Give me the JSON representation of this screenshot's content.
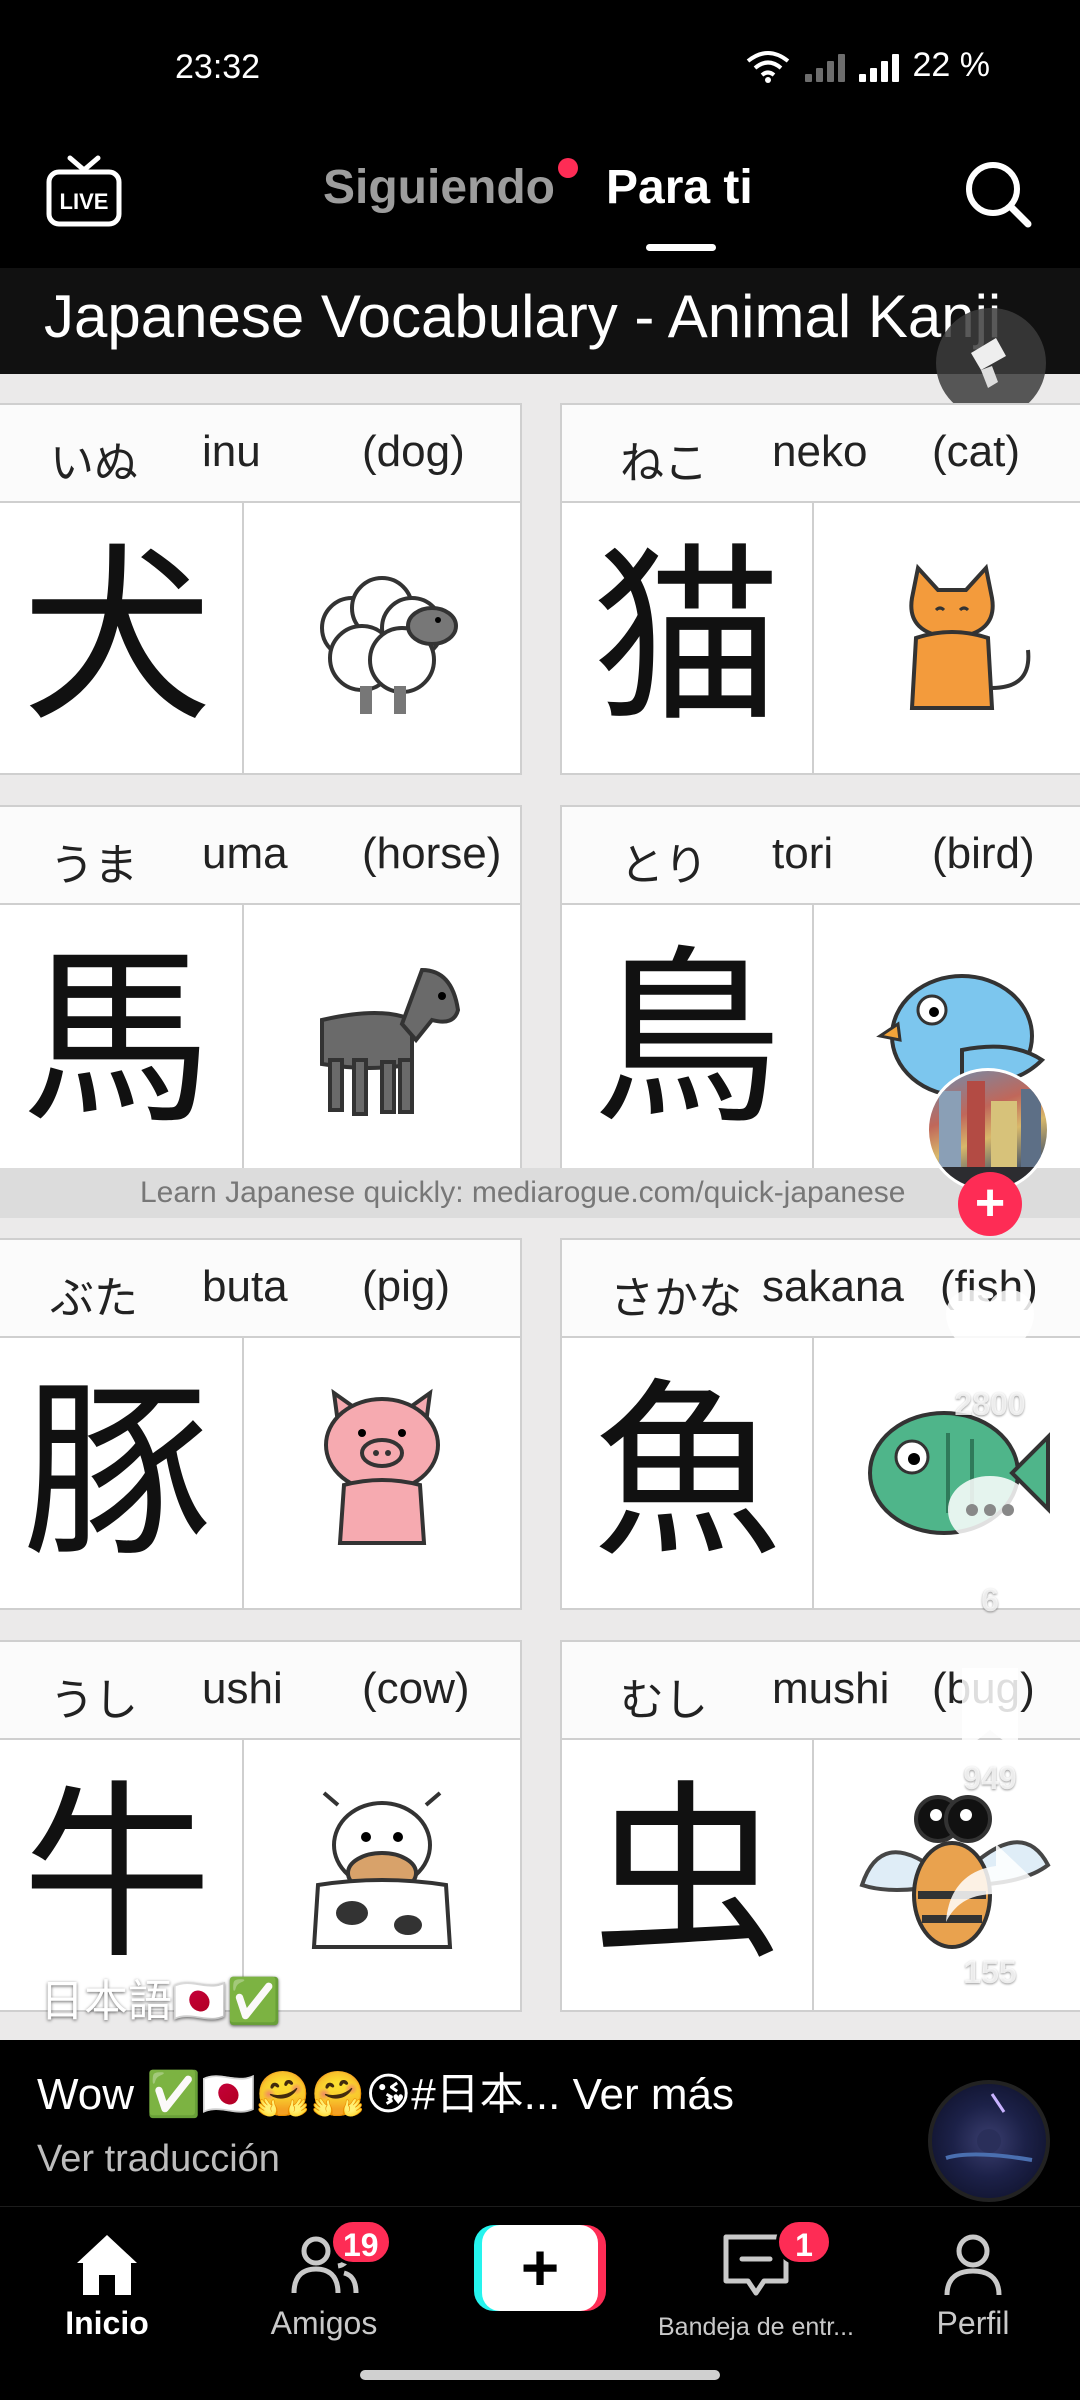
{
  "status_bar": {
    "time": "23:32",
    "battery": "22 %"
  },
  "top_nav": {
    "live_label": "LIVE",
    "tab_following": "Siguiendo",
    "tab_for_you": "Para ti"
  },
  "video": {
    "title": "Japanese Vocabulary - Animal Kanji",
    "watermark": "Learn Japanese quickly: mediarogue.com/quick-japanese",
    "overlay_text": "日本語🇯🇵✅",
    "cards": [
      {
        "kana": "いぬ",
        "romaji": "inu",
        "meaning": "(dog)",
        "kanji": "犬",
        "animal": "sheep-illustration"
      },
      {
        "kana": "ねこ",
        "romaji": "neko",
        "meaning": "(cat)",
        "kanji": "猫",
        "animal": "cat-illustration"
      },
      {
        "kana": "うま",
        "romaji": "uma",
        "meaning": "(horse)",
        "kanji": "馬",
        "animal": "horse-illustration"
      },
      {
        "kana": "とり",
        "romaji": "tori",
        "meaning": "(bird)",
        "kanji": "鳥",
        "animal": "bird-illustration"
      },
      {
        "kana": "ぶた",
        "romaji": "buta",
        "meaning": "(pig)",
        "kanji": "豚",
        "animal": "pig-illustration"
      },
      {
        "kana": "さかな",
        "romaji": "sakana",
        "meaning": "(fish)",
        "kanji": "魚",
        "animal": "fish-illustration"
      },
      {
        "kana": "うし",
        "romaji": "ushi",
        "meaning": "(cow)",
        "kanji": "牛",
        "animal": "cow-illustration"
      },
      {
        "kana": "むし",
        "romaji": "mushi",
        "meaning": "(bug)",
        "kanji": "虫",
        "animal": "bee-illustration"
      }
    ]
  },
  "actions": {
    "likes": "2800",
    "comments": "6",
    "saves": "949",
    "shares": "155"
  },
  "caption": {
    "text": "Wow ✅🇯🇵🤗🤗😘#日本...",
    "more": "Ver más",
    "translate": "Ver traducción"
  },
  "bottom_nav": {
    "home": "Inicio",
    "friends": "Amigos",
    "friends_badge": "19",
    "inbox": "Bandeja de entr...",
    "inbox_badge": "1",
    "profile": "Perfil"
  },
  "colors": {
    "accent": "#fe2c55",
    "cyan": "#25f4ee",
    "background": "#000000"
  }
}
